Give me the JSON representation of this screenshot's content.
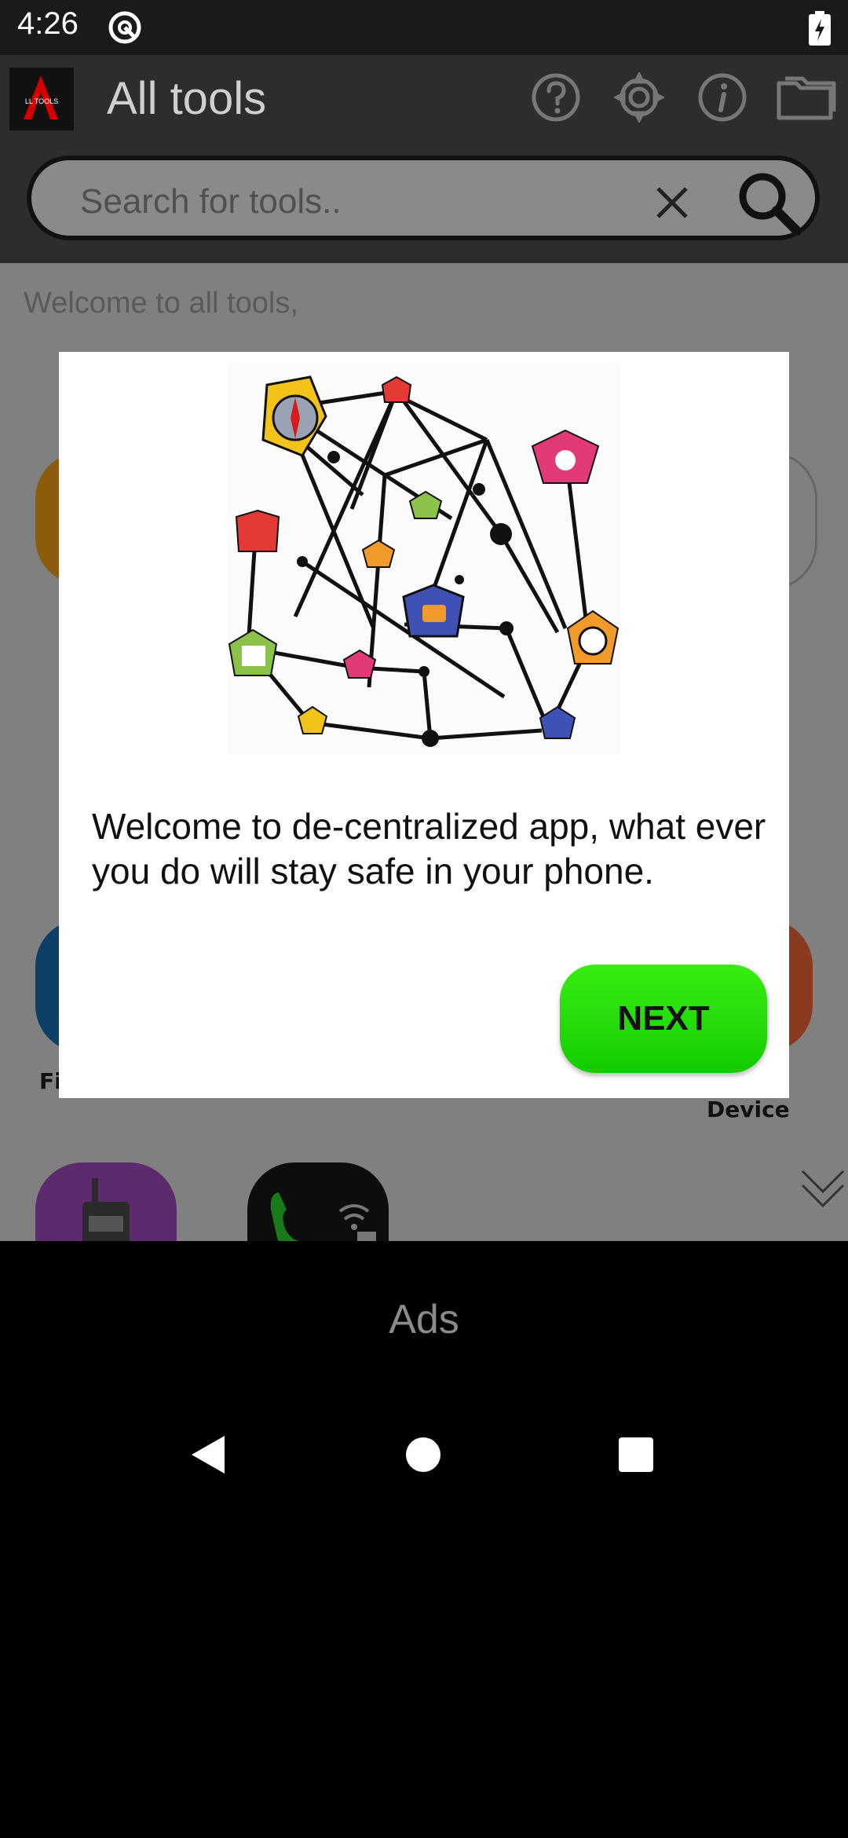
{
  "status_bar": {
    "time": "4:26"
  },
  "app_bar": {
    "title": "All tools",
    "icons": [
      "help-icon",
      "settings-icon",
      "info-icon",
      "folder-icon"
    ]
  },
  "search": {
    "placeholder": "Search for tools.."
  },
  "content": {
    "welcome": "Welcome to all tools,",
    "tile_label_left": "Fi",
    "tile_label_right": "Device"
  },
  "dialog": {
    "message": "Welcome to de-centralized app, what ever you do will stay safe in your phone.",
    "next_label": "NEXT"
  },
  "ads": {
    "label": "Ads"
  },
  "colors": {
    "accent_green": "#1fdc00",
    "app_bar": "#2d2d2d"
  }
}
